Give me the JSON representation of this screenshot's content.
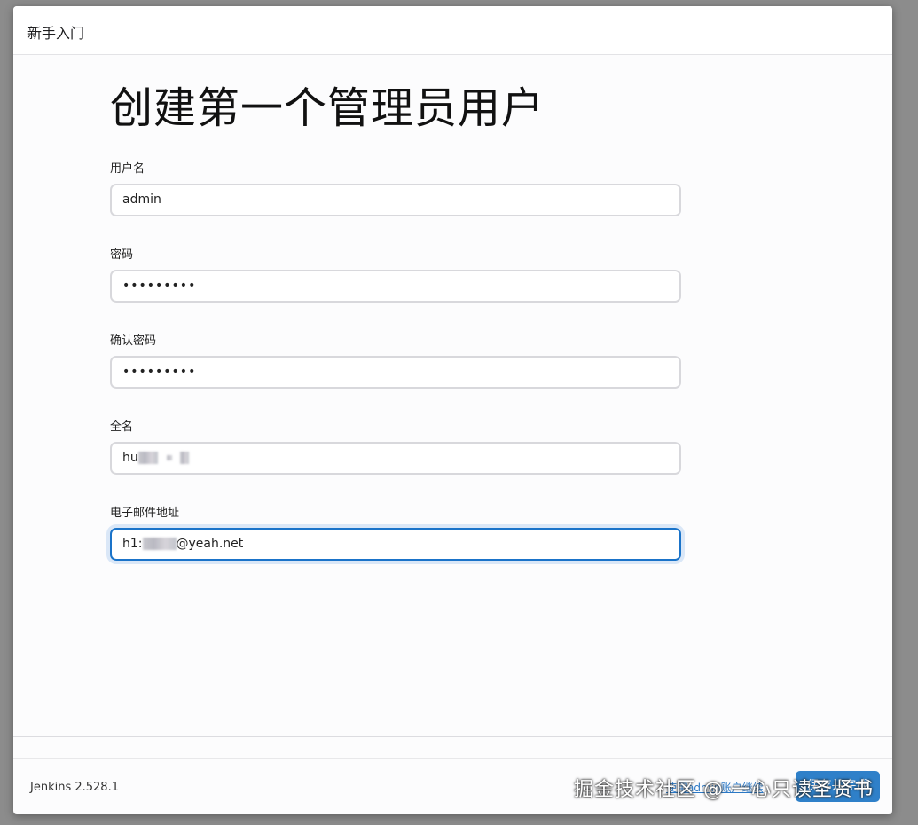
{
  "dialog": {
    "title": "新手入门"
  },
  "page": {
    "heading": "创建第一个管理员用户"
  },
  "form": {
    "username": {
      "label": "用户名",
      "value": "admin"
    },
    "password": {
      "label": "密码",
      "value": "•••••••••"
    },
    "confirm_password": {
      "label": "确认密码",
      "value": "•••••••••"
    },
    "fullname": {
      "label": "全名",
      "value_prefix": "hu"
    },
    "email": {
      "label": "电子邮件地址",
      "value_prefix": "h1:",
      "value_suffix": "@yeah.net"
    }
  },
  "footer": {
    "version": "Jenkins 2.528.1",
    "skip_link": "使用admin账户继续",
    "primary_button": "保存并完成"
  },
  "overlay": {
    "watermark": "掘金技术社区 @ 一心只读圣贤书"
  },
  "colors": {
    "accent": "#2f80c9",
    "focus_border": "#1a73c9",
    "link": "#2b78c5"
  }
}
